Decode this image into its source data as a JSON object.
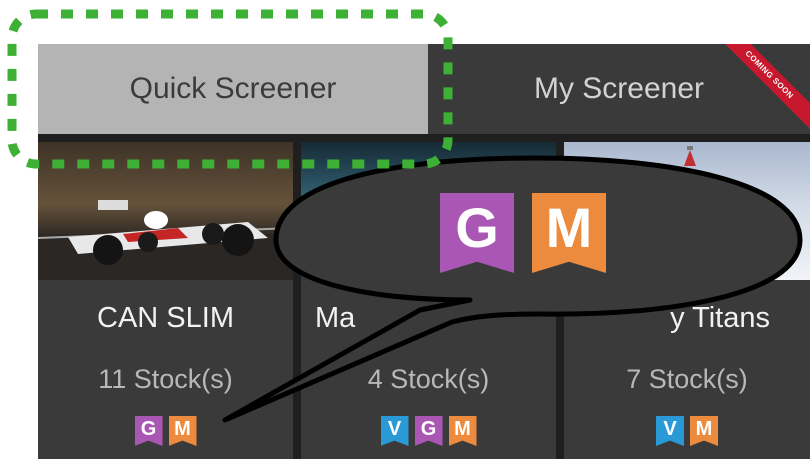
{
  "tabs": {
    "quick": "Quick Screener",
    "my": "My Screener",
    "ribbon": "COMING SOON"
  },
  "cards": [
    {
      "title": "CAN SLIM",
      "count": "11 Stock(s)",
      "badges": [
        "G",
        "M"
      ]
    },
    {
      "title": "Ma",
      "count": "4 Stock(s)",
      "badges": [
        "V",
        "G",
        "M"
      ]
    },
    {
      "title": "y Titans",
      "count": "7 Stock(s)",
      "badges": [
        "V",
        "M"
      ]
    }
  ],
  "callout": {
    "badges": [
      "G",
      "M"
    ]
  },
  "colors": {
    "growth": "#a956b5",
    "momentum": "#ec8a3d",
    "value": "#2a9ad6",
    "highlight": "#3db035",
    "ribbon": "#c8182d"
  }
}
